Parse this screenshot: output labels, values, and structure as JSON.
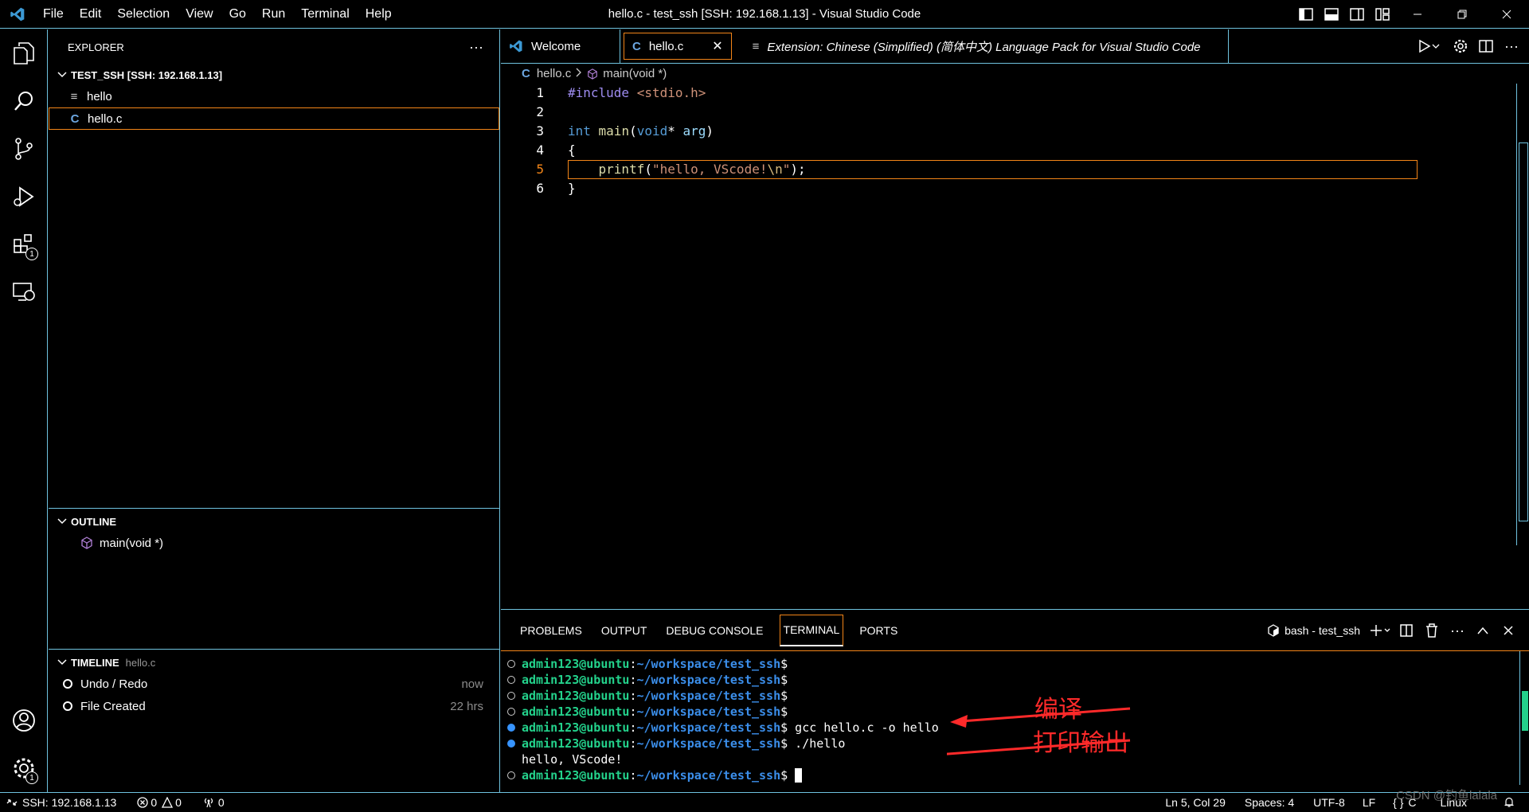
{
  "titlebar": {
    "window_title": "hello.c - test_ssh [SSH: 192.168.1.13] - Visual Studio Code",
    "menu": [
      "File",
      "Edit",
      "Selection",
      "View",
      "Go",
      "Run",
      "Terminal",
      "Help"
    ]
  },
  "activitybar": {
    "extensions_badge": "1",
    "manage_badge": "1"
  },
  "sidebar": {
    "explorer_title": "EXPLORER",
    "more_label": "···",
    "workspace_title": "TEST_SSH [SSH: 192.168.1.13]",
    "files": [
      {
        "name": "hello",
        "icon": "≡"
      },
      {
        "name": "hello.c",
        "icon": "C"
      }
    ],
    "outline_title": "OUTLINE",
    "outline_items": [
      "main(void *)"
    ],
    "timeline_title": "TIMELINE",
    "timeline_file": "hello.c",
    "timeline_items": [
      {
        "label": "Undo / Redo",
        "when": "now"
      },
      {
        "label": "File Created",
        "when": "22 hrs"
      }
    ]
  },
  "editor": {
    "tabs": [
      {
        "label": "Welcome"
      },
      {
        "label": "hello.c",
        "close": "✕"
      },
      {
        "label": "Extension: Chinese (Simplified) (简体中文) Language Pack for Visual Studio Code"
      }
    ],
    "breadcrumb": {
      "file": "hello.c",
      "symbol": "main(void *)"
    },
    "line_numbers": [
      "1",
      "2",
      "3",
      "4",
      "5",
      "6"
    ],
    "code": {
      "l1_pp": "#include",
      "l1_inc": " <stdio.h>",
      "l3_kw": "int",
      "l3_fn": " main",
      "l3_p1": "(",
      "l3_void": "void",
      "l3_star": "* ",
      "l3_arg": "arg",
      "l3_p2": ")",
      "l4": "{",
      "l5_indent": "    ",
      "l5_fn": "printf",
      "l5_p1": "(",
      "l5_str": "\"hello, VScode!",
      "l5_esc": "\\n",
      "l5_str2": "\"",
      "l5_p2": ");",
      "l6": "}"
    },
    "current_line": 5
  },
  "panel": {
    "tabs": [
      "PROBLEMS",
      "OUTPUT",
      "DEBUG CONSOLE",
      "TERMINAL",
      "PORTS"
    ],
    "active_tab": "TERMINAL",
    "terminal_name": "bash - test_ssh",
    "terminal_lines": [
      {
        "user": "admin123@ubuntu",
        "path": "~/workspace/test_ssh",
        "cmd": "",
        "mark": "circle"
      },
      {
        "user": "admin123@ubuntu",
        "path": "~/workspace/test_ssh",
        "cmd": "",
        "mark": "circle"
      },
      {
        "user": "admin123@ubuntu",
        "path": "~/workspace/test_ssh",
        "cmd": "",
        "mark": "circle"
      },
      {
        "user": "admin123@ubuntu",
        "path": "~/workspace/test_ssh",
        "cmd": "",
        "mark": "circle"
      },
      {
        "user": "admin123@ubuntu",
        "path": "~/workspace/test_ssh",
        "cmd": " gcc hello.c -o hello",
        "mark": "filled"
      },
      {
        "user": "admin123@ubuntu",
        "path": "~/workspace/test_ssh",
        "cmd": " ./hello",
        "mark": "filled"
      }
    ],
    "output_line": "hello, VScode!",
    "last_prompt": {
      "user": "admin123@ubuntu",
      "path": "~/workspace/test_ssh"
    },
    "annotation_compile": "编译",
    "annotation_print": "打印输出"
  },
  "statusbar": {
    "remote": "SSH: 192.168.1.13",
    "errors": "0",
    "warnings": "0",
    "ports": "0",
    "position": "Ln 5, Col 29",
    "spaces": "Spaces: 4",
    "encoding": "UTF-8",
    "eol": "LF",
    "language": "C",
    "platform": "Linux",
    "watermark": "CSDN @钓鱼lalala"
  },
  "colors": {
    "border": "#6fc3df",
    "focus": "#f38518",
    "term_user": "#23d18b",
    "term_path": "#3b8eea",
    "annotation": "#ff2a2a"
  }
}
